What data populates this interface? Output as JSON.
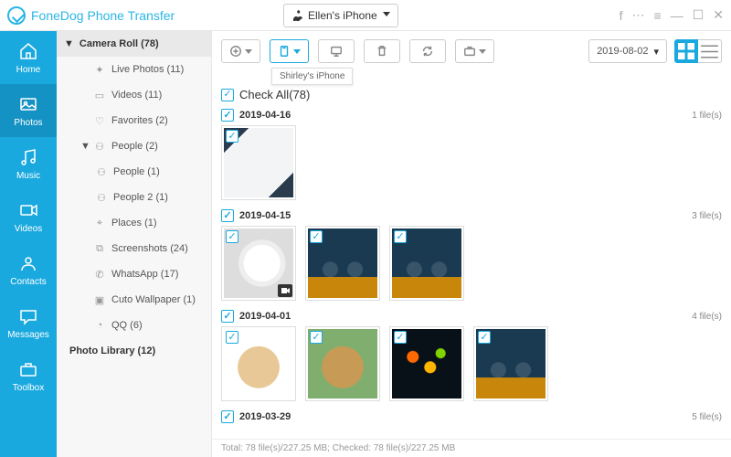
{
  "title": "FoneDog Phone Transfer",
  "device": "Ellen's iPhone",
  "nav": [
    {
      "key": "home",
      "label": "Home"
    },
    {
      "key": "photos",
      "label": "Photos"
    },
    {
      "key": "music",
      "label": "Music"
    },
    {
      "key": "videos",
      "label": "Videos"
    },
    {
      "key": "contacts",
      "label": "Contacts"
    },
    {
      "key": "messages",
      "label": "Messages"
    },
    {
      "key": "toolbox",
      "label": "Toolbox"
    }
  ],
  "nav_active": "photos",
  "sidebar": {
    "camera_roll": {
      "label": "Camera Roll",
      "count": 78
    },
    "items": [
      {
        "label": "Live Photos",
        "count": 11,
        "icon": "sparkle"
      },
      {
        "label": "Videos",
        "count": 11,
        "icon": "video"
      },
      {
        "label": "Favorites",
        "count": 2,
        "icon": "heart"
      },
      {
        "label": "People",
        "count": 2,
        "icon": "people",
        "expanded": true,
        "children": [
          {
            "label": "People",
            "count": 1
          },
          {
            "label": "People 2",
            "count": 1
          }
        ]
      },
      {
        "label": "Places",
        "count": 1,
        "icon": "pin"
      },
      {
        "label": "Screenshots",
        "count": 24,
        "icon": "screenshot"
      },
      {
        "label": "WhatsApp",
        "count": 17,
        "icon": "whatsapp"
      },
      {
        "label": "Cuto Wallpaper",
        "count": 1,
        "icon": "wallpaper"
      },
      {
        "label": "QQ",
        "count": 6,
        "icon": "qq"
      }
    ],
    "photo_library": {
      "label": "Photo Library",
      "count": 12
    }
  },
  "toolbar": {
    "tooltip": "Shirley's iPhone",
    "date": "2019-08-02"
  },
  "checkall": {
    "label": "Check All",
    "count": 78
  },
  "groups": [
    {
      "date": "2019-04-16",
      "count": "1 file(s)",
      "thumbs": [
        {
          "cls": "tg1"
        }
      ]
    },
    {
      "date": "2019-04-15",
      "count": "3 file(s)",
      "thumbs": [
        {
          "cls": "tg-mug",
          "video": true
        },
        {
          "cls": "tg-drink"
        },
        {
          "cls": "tg-drink"
        }
      ]
    },
    {
      "date": "2019-04-01",
      "count": "4 file(s)",
      "thumbs": [
        {
          "cls": "tg-pup1"
        },
        {
          "cls": "tg-pup2"
        },
        {
          "cls": "tg-lights"
        },
        {
          "cls": "tg-drink"
        }
      ]
    },
    {
      "date": "2019-03-29",
      "count": "5 file(s)",
      "thumbs": []
    }
  ],
  "status": "Total: 78 file(s)/227.25 MB; Checked: 78 file(s)/227.25 MB"
}
